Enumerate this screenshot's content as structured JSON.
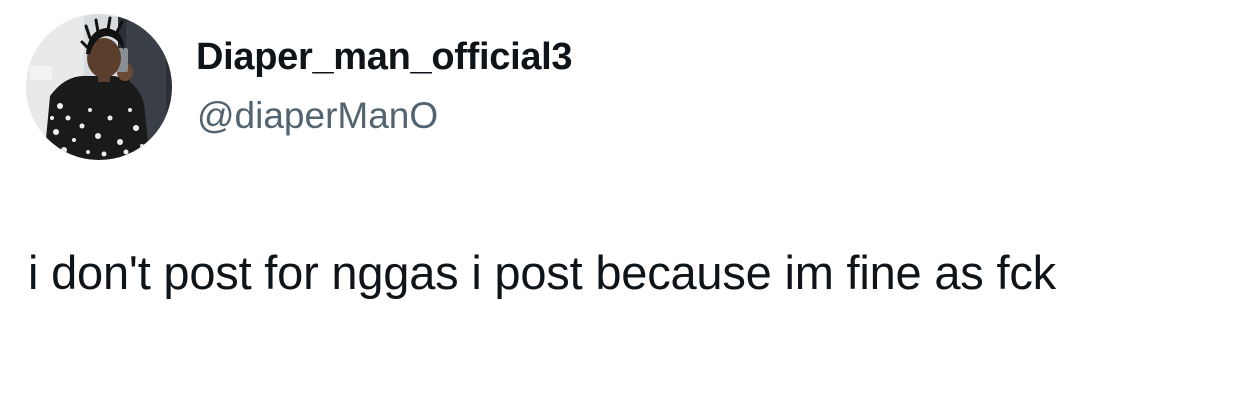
{
  "tweet": {
    "author": {
      "display_name": "Diaper_man_official3",
      "handle": "@diaperManO",
      "avatar_icon": "profile-photo"
    },
    "text": "i don't post for nggas i post because im fine as fck"
  },
  "colors": {
    "text_primary": "#0f1419",
    "text_secondary": "#536471",
    "background": "#ffffff"
  }
}
